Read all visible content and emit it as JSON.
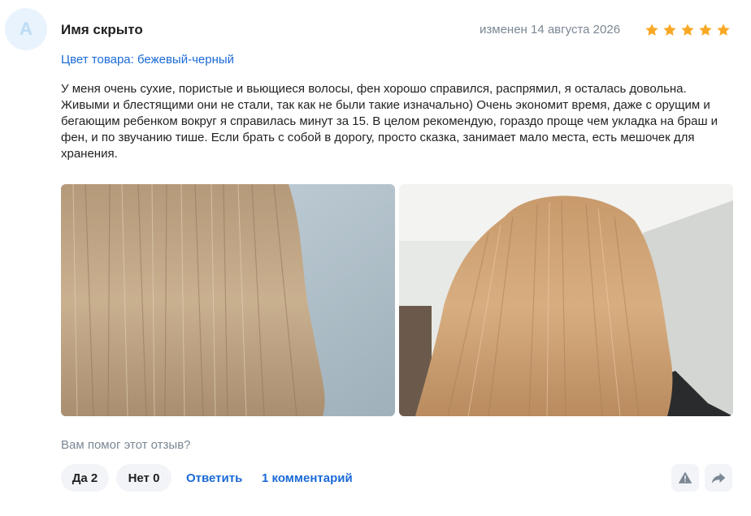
{
  "review": {
    "avatar_letter": "А",
    "author": "Имя скрыто",
    "date": "изменен 14 августа 2026",
    "rating": 5,
    "rating_max": 5,
    "star_color": "#f9a825",
    "product_color": "Цвет товара: бежевый-черный",
    "text": "У меня очень сухие, пористые и вьющиеся волосы, фен хорошо справился, распрямил, я осталась довольна. Живыми и блестящими они не стали, так как не были такие изначально) Очень экономит время, даже с орущим и бегающим ребенком вокруг я справилась минут за 15. В целом рекомендую, гораздо проще чем укладка на браш и фен, и по звучанию тише. Если брать с собой в дорогу, просто сказка, занимает мало места, есть мешочек для хранения.",
    "photos_count": 2
  },
  "actions": {
    "helpful_question": "Вам помог этот отзыв?",
    "yes_label": "Да 2",
    "no_label": "Нет 0",
    "reply_label": "Ответить",
    "comments_label": "1 комментарий",
    "report_icon": "warning-icon",
    "share_icon": "share-arrow-icon"
  },
  "colors": {
    "link": "#1b6ad6",
    "muted": "#7b8794",
    "pill_bg": "#f2f4f7"
  }
}
